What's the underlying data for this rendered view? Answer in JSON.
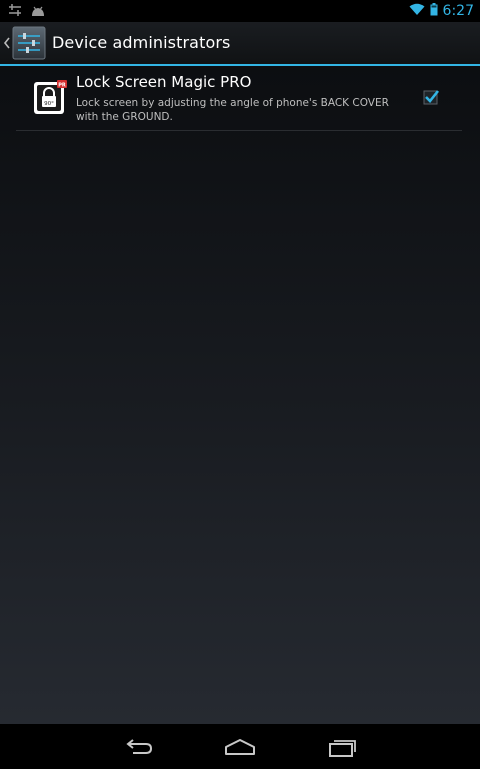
{
  "status_bar": {
    "time": "6:27",
    "left_icons": [
      "usb-debug-icon",
      "android-notification-icon"
    ],
    "right_icons": [
      "wifi-icon",
      "battery-icon"
    ],
    "accent_color": "#33b5e5"
  },
  "action_bar": {
    "title": "Device administrators",
    "icon": "settings-sliders-icon",
    "up_indicator": "chevron-left-icon"
  },
  "admins": [
    {
      "title": "Lock Screen Magic PRO",
      "description": "Lock screen by adjusting the angle of phone's BACK COVER with the GROUND.",
      "icon": "lock-screen-magic-app-icon",
      "icon_badge": "90°",
      "checked": true
    }
  ],
  "nav_bar": {
    "buttons": [
      "back-icon",
      "home-icon",
      "recents-icon"
    ]
  },
  "colors": {
    "accent": "#33b5e5",
    "divider": "#2a2d31",
    "secondary_text": "#bfbfbf"
  }
}
